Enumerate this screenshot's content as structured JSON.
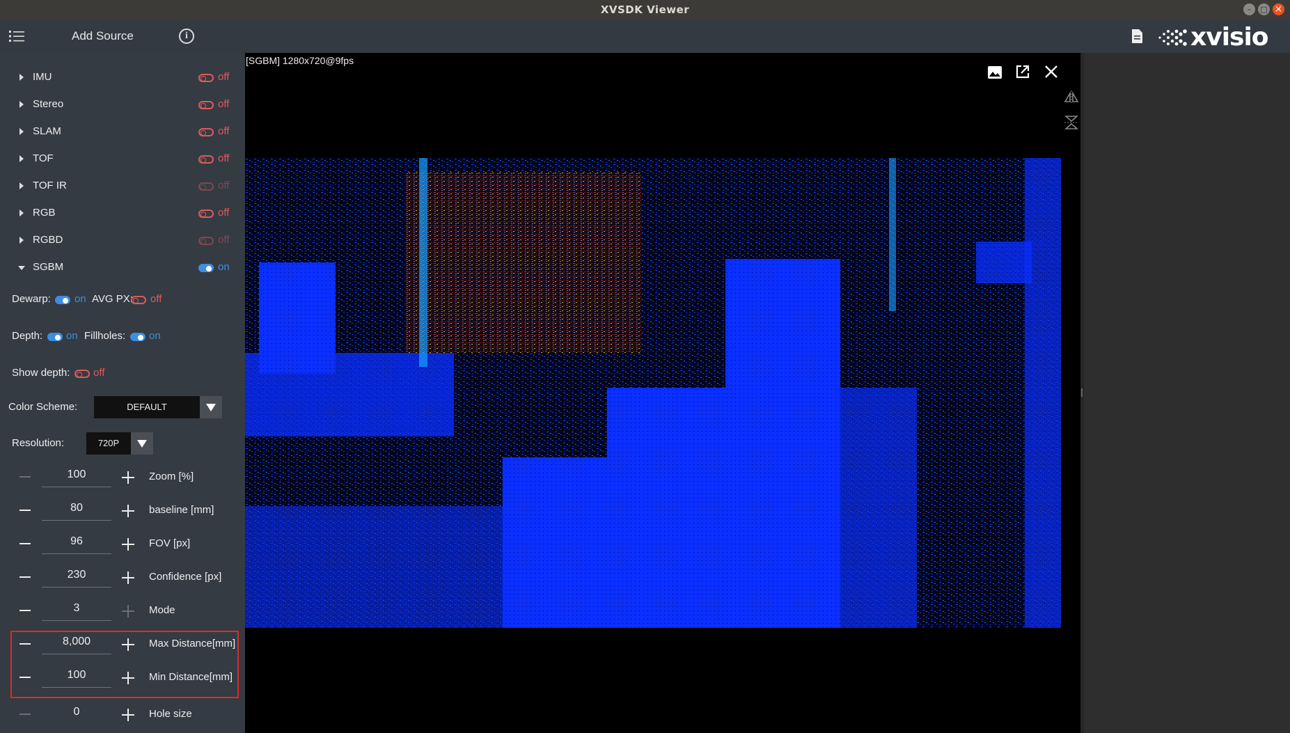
{
  "window": {
    "title": "XVSDK Viewer"
  },
  "header": {
    "add_source_label": "Add Source",
    "logo_text": "xvisio"
  },
  "sidebar": {
    "sources": [
      {
        "label": "IMU",
        "state": "off",
        "enabled": true
      },
      {
        "label": "Stereo",
        "state": "off",
        "enabled": true
      },
      {
        "label": "SLAM",
        "state": "off",
        "enabled": true
      },
      {
        "label": "TOF",
        "state": "off",
        "enabled": true
      },
      {
        "label": "TOF IR",
        "state": "off",
        "enabled": false
      },
      {
        "label": "RGB",
        "state": "off",
        "enabled": true
      },
      {
        "label": "RGBD",
        "state": "off",
        "enabled": false
      },
      {
        "label": "SGBM",
        "state": "on",
        "enabled": true
      }
    ],
    "sgbm_options": {
      "dewarp": {
        "label": "Dewarp:",
        "state": "on"
      },
      "avg_px": {
        "label": "AVG PX:",
        "state": "off"
      },
      "depth": {
        "label": "Depth:",
        "state": "on"
      },
      "fillholes": {
        "label": "Fillholes:",
        "state": "on"
      },
      "show_depth": {
        "label": "Show depth:",
        "state": "off"
      },
      "color_scheme": {
        "label": "Color Scheme:",
        "value": "DEFAULT"
      },
      "resolution": {
        "label": "Resolution:",
        "value": "720P"
      }
    },
    "params": [
      {
        "value": "100",
        "label": "Zoom [%]"
      },
      {
        "value": "80",
        "label": "baseline [mm]"
      },
      {
        "value": "96",
        "label": "FOV [px]"
      },
      {
        "value": "230",
        "label": "Confidence [px]"
      },
      {
        "value": "3",
        "label": "Mode"
      },
      {
        "value": "8,000",
        "label": "Max Distance[mm]"
      },
      {
        "value": "100",
        "label": "Min Distance[mm]"
      },
      {
        "value": "0",
        "label": "Hole size"
      }
    ]
  },
  "viewer": {
    "caption": "[SGBM]  1280x720@9fps",
    "icons": [
      "image-icon",
      "open-external-icon",
      "close-icon",
      "flip-horizontal-icon",
      "flip-vertical-icon"
    ]
  },
  "colors": {
    "on": "#3d8fe0",
    "off": "#e05a5a",
    "highlight": "#e02a2a",
    "depth_base": "#0a2fff"
  }
}
